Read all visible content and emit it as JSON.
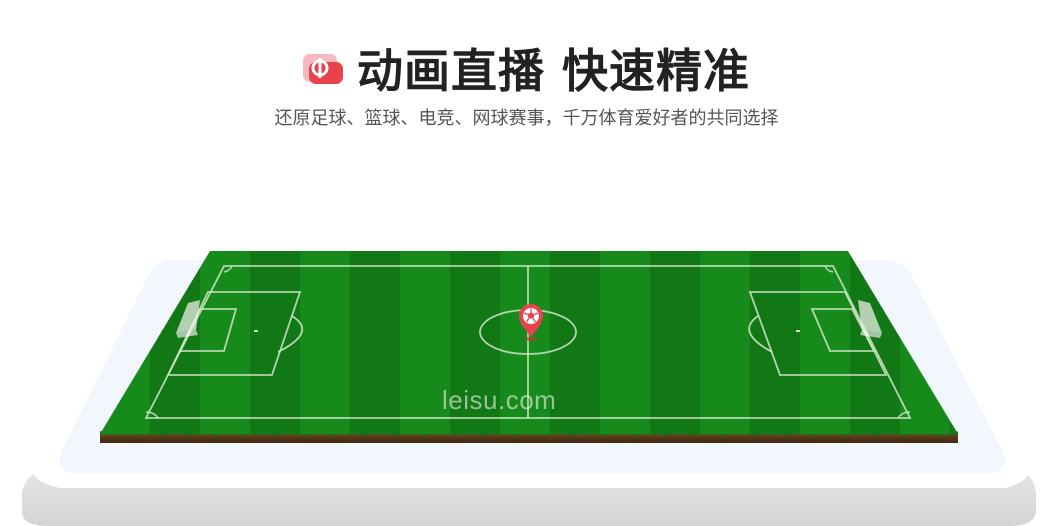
{
  "header": {
    "logo_icon": "leisu-logo-icon",
    "title": "动画直播 快速精准",
    "subtitle": "还原足球、篮球、电竞、网球赛事，千万体育爱好者的共同选择"
  },
  "pitch": {
    "watermark": "leisu.com",
    "ball_marker_icon": "soccer-ball-location-pin-icon"
  },
  "colors": {
    "brand_red": "#e8434d",
    "grass_dark": "#15801a",
    "grass_light": "#1f9124",
    "platform": "#f2f6fd"
  }
}
